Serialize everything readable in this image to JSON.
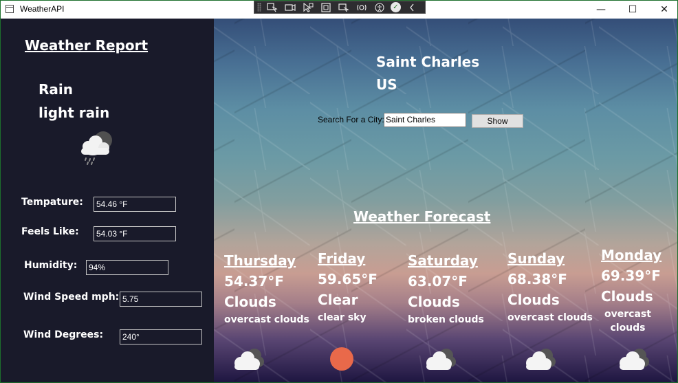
{
  "window": {
    "title": "WeatherAPI",
    "controls": {
      "minimize": "—",
      "maximize": "☐",
      "close": "✕"
    }
  },
  "debug_toolbar": {
    "icons": [
      "select-element-icon",
      "display-layout-adorners-icon",
      "track-focus-icon",
      "preview-selection-icon",
      "accessibility-icon",
      "hot-reload-ok-icon",
      "collapse-icon"
    ]
  },
  "sidebar": {
    "title": "Weather Report",
    "condition_main": "Rain",
    "condition_desc": "light rain",
    "icon": "rain-cloud-icon",
    "fields": {
      "temperature": {
        "label": "Tempature:",
        "value": "54.46 °F"
      },
      "feels_like": {
        "label": "Feels Like:",
        "value": "54.03  °F"
      },
      "humidity": {
        "label": "Humidity:",
        "value": "94%"
      },
      "wind_speed": {
        "label": "Wind Speed mph:",
        "value": "5.75"
      },
      "wind_degrees": {
        "label": "Wind Degrees:",
        "value": "240°"
      }
    }
  },
  "main": {
    "city": "Saint Charles",
    "country": "US",
    "search": {
      "label": "Search For a City:",
      "value": "Saint Charles"
    },
    "show_button": "Show",
    "forecast_title": "Weather Forecast",
    "colors": {
      "sun": "#e9694a"
    },
    "forecast": [
      {
        "day": "Thursday",
        "temp": "54.37°F",
        "main": "Clouds",
        "desc": "overcast clouds",
        "icon": "clouds-icon"
      },
      {
        "day": "Friday",
        "temp": "59.65°F",
        "main": "Clear",
        "desc": "clear sky",
        "icon": "sun-icon"
      },
      {
        "day": "Saturday",
        "temp": "63.07°F",
        "main": "Clouds",
        "desc": "broken clouds",
        "icon": "clouds-icon"
      },
      {
        "day": "Sunday",
        "temp": "68.38°F",
        "main": "Clouds",
        "desc": "overcast clouds",
        "icon": "clouds-icon"
      },
      {
        "day": "Monday",
        "temp": "69.39°F",
        "main": "Clouds",
        "desc": "overcast clouds",
        "icon": "clouds-icon"
      }
    ]
  }
}
